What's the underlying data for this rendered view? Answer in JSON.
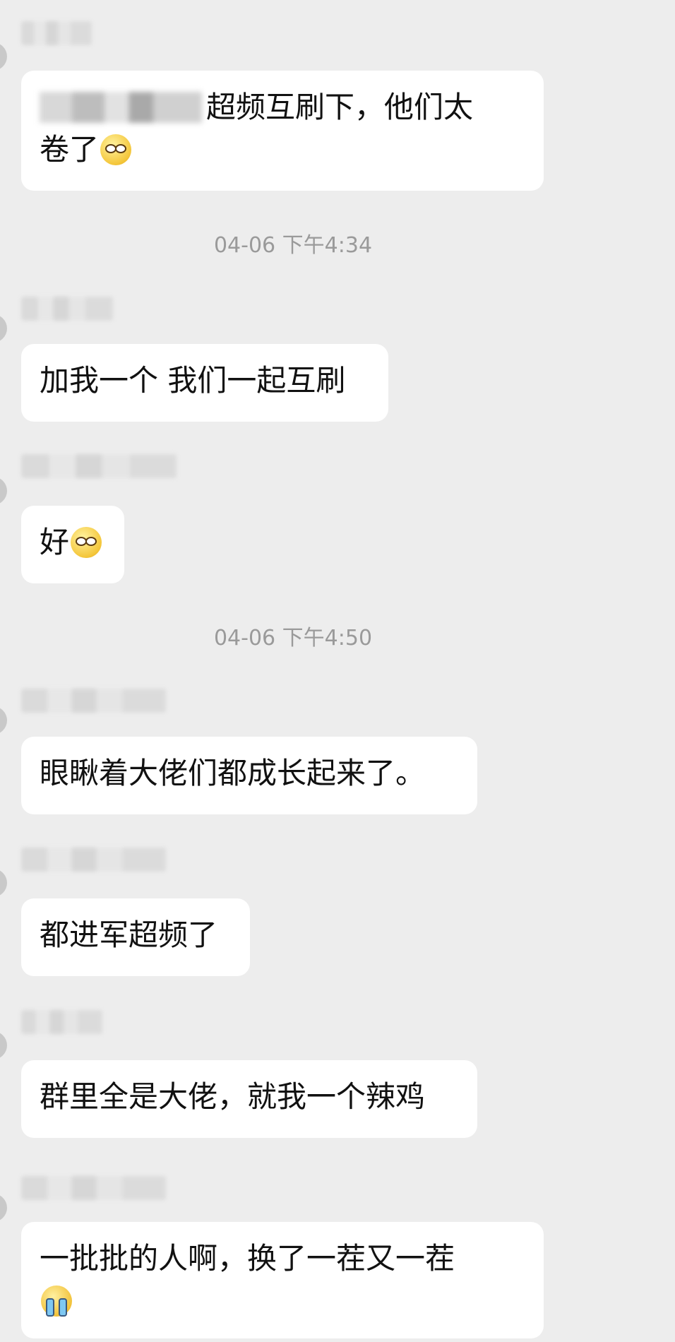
{
  "messages": [
    {
      "text_line1": "超频互刷下，他们太",
      "text_line2": "卷了",
      "emoji": "smirk-emoji"
    },
    {
      "text": "加我一个 我们一起互刷"
    },
    {
      "text": "好",
      "emoji": "smirk-emoji"
    },
    {
      "text": "眼瞅着大佬们都成长起来了。"
    },
    {
      "text": "都进军超频了"
    },
    {
      "text": "群里全是大佬，就我一个辣鸡"
    },
    {
      "text": "一批批的人啊，换了一茬又一茬",
      "emoji": "crying-emoji"
    }
  ],
  "timestamps": [
    "04-06 下午4:34",
    "04-06 下午4:50"
  ]
}
